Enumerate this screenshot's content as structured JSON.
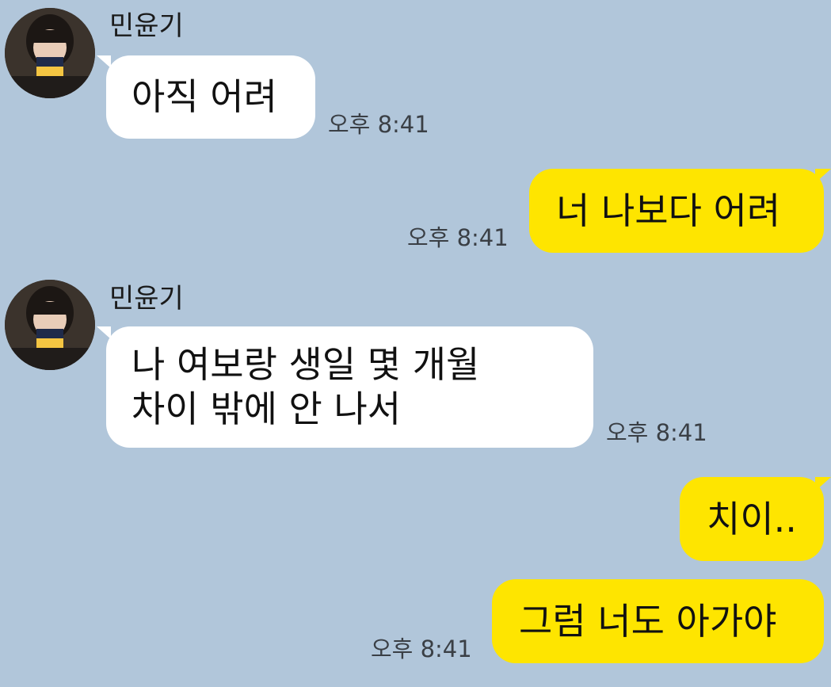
{
  "chat": {
    "messages": [
      {
        "direction": "incoming",
        "sender": "민윤기",
        "lines": [
          "아직 어려"
        ],
        "time": "오후 8:41"
      },
      {
        "direction": "outgoing",
        "lines": [
          "너 나보다 어려"
        ],
        "time": "오후 8:41"
      },
      {
        "direction": "incoming",
        "sender": "민윤기",
        "lines": [
          "나 여보랑 생일 몇 개월",
          "차이 밖에 안 나서"
        ],
        "time": "오후 8:41"
      },
      {
        "direction": "outgoing",
        "lines": [
          "치이.."
        ],
        "time": ""
      },
      {
        "direction": "outgoing",
        "lines": [
          "그럼 너도 아가야"
        ],
        "time": "오후 8:41"
      }
    ]
  },
  "colors": {
    "background": "#b1c6da",
    "incoming_bubble": "#ffffff",
    "outgoing_bubble": "#fee500",
    "timestamp_text": "#3a3f45"
  }
}
